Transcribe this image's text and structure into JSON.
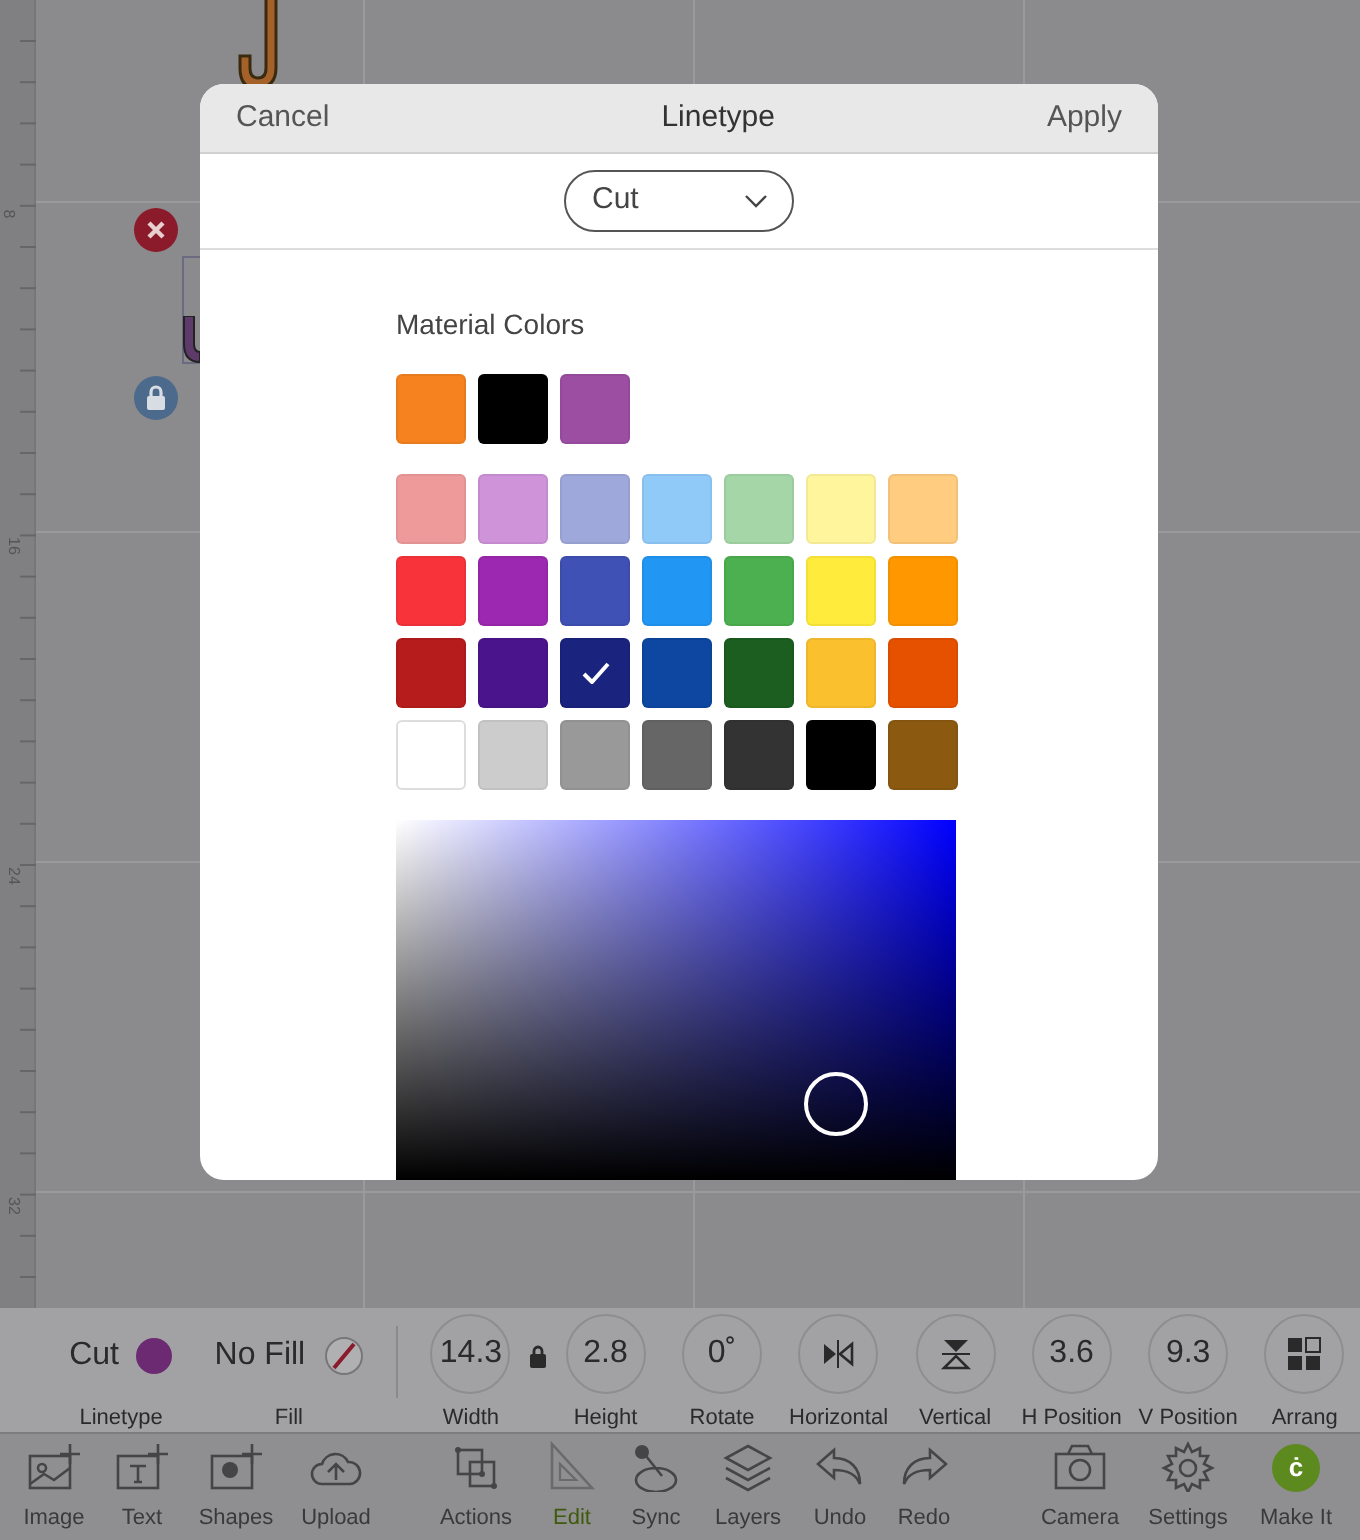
{
  "canvas": {
    "ruler_marks": [
      "8",
      "16",
      "24",
      "32"
    ]
  },
  "dialog": {
    "cancel": "Cancel",
    "title": "Linetype",
    "apply": "Apply",
    "linetype_select": "Cut",
    "section_title": "Material Colors",
    "material_colors": [
      {
        "color": "#f5821f",
        "selected": false
      },
      {
        "color": "#000000",
        "selected": false
      },
      {
        "color": "#9c4ea3",
        "selected": false
      }
    ],
    "palette": [
      [
        {
          "color": "#ef9a9a",
          "selected": false
        },
        {
          "color": "#ce93d8",
          "selected": false
        },
        {
          "color": "#9fa8da",
          "selected": false
        },
        {
          "color": "#90caf9",
          "selected": false
        },
        {
          "color": "#a5d6a7",
          "selected": false
        },
        {
          "color": "#fff59d",
          "selected": false
        },
        {
          "color": "#ffcc80",
          "selected": false
        }
      ],
      [
        {
          "color": "#f8333a",
          "selected": false
        },
        {
          "color": "#9c27b0",
          "selected": false
        },
        {
          "color": "#3f51b5",
          "selected": false
        },
        {
          "color": "#2196f3",
          "selected": false
        },
        {
          "color": "#4caf50",
          "selected": false
        },
        {
          "color": "#ffeb3b",
          "selected": false
        },
        {
          "color": "#ff9800",
          "selected": false
        }
      ],
      [
        {
          "color": "#b71c1c",
          "selected": false
        },
        {
          "color": "#4a148c",
          "selected": false
        },
        {
          "color": "#1a237e",
          "selected": true
        },
        {
          "color": "#0d47a1",
          "selected": false
        },
        {
          "color": "#1b5e20",
          "selected": false
        },
        {
          "color": "#fbc02d",
          "selected": false
        },
        {
          "color": "#e65100",
          "selected": false
        }
      ],
      [
        {
          "color": "#ffffff",
          "selected": false
        },
        {
          "color": "#cccccc",
          "selected": false
        },
        {
          "color": "#999999",
          "selected": false
        },
        {
          "color": "#666666",
          "selected": false
        },
        {
          "color": "#333333",
          "selected": false
        },
        {
          "color": "#000000",
          "selected": false
        },
        {
          "color": "#8b5a10",
          "selected": false
        }
      ]
    ]
  },
  "properties": [
    {
      "kind": "linetype",
      "value": "Cut",
      "label": "Linetype",
      "color": "#6b2a72"
    },
    {
      "kind": "fill",
      "value": "No Fill",
      "label": "Fill"
    },
    {
      "kind": "value",
      "value": "14.3",
      "label": "Width"
    },
    {
      "kind": "lock"
    },
    {
      "kind": "value",
      "value": "2.8",
      "label": "Height"
    },
    {
      "kind": "value",
      "value": "0˚",
      "label": "Rotate"
    },
    {
      "kind": "flip-h",
      "label": "Horizontal"
    },
    {
      "kind": "flip-v",
      "label": "Vertical"
    },
    {
      "kind": "value",
      "value": "3.6",
      "label": "H Position"
    },
    {
      "kind": "value",
      "value": "9.3",
      "label": "V Position"
    },
    {
      "kind": "arrange",
      "label": "Arrang"
    }
  ],
  "toolbar": [
    {
      "kind": "image",
      "label": "Image",
      "selected": false
    },
    {
      "kind": "text",
      "label": "Text",
      "selected": false
    },
    {
      "kind": "shapes",
      "label": "Shapes",
      "selected": false
    },
    {
      "kind": "upload",
      "label": "Upload",
      "selected": false
    },
    {
      "kind": "actions",
      "label": "Actions",
      "selected": false
    },
    {
      "kind": "edit",
      "label": "Edit",
      "selected": true
    },
    {
      "kind": "sync",
      "label": "Sync",
      "selected": false
    },
    {
      "kind": "layers",
      "label": "Layers",
      "selected": false
    },
    {
      "kind": "undo",
      "label": "Undo",
      "selected": false
    },
    {
      "kind": "redo",
      "label": "Redo",
      "selected": false
    },
    {
      "kind": "camera",
      "label": "Camera",
      "selected": false
    },
    {
      "kind": "settings",
      "label": "Settings",
      "selected": false
    },
    {
      "kind": "make",
      "label": "Make It",
      "selected": false,
      "badge": "ċ"
    }
  ]
}
